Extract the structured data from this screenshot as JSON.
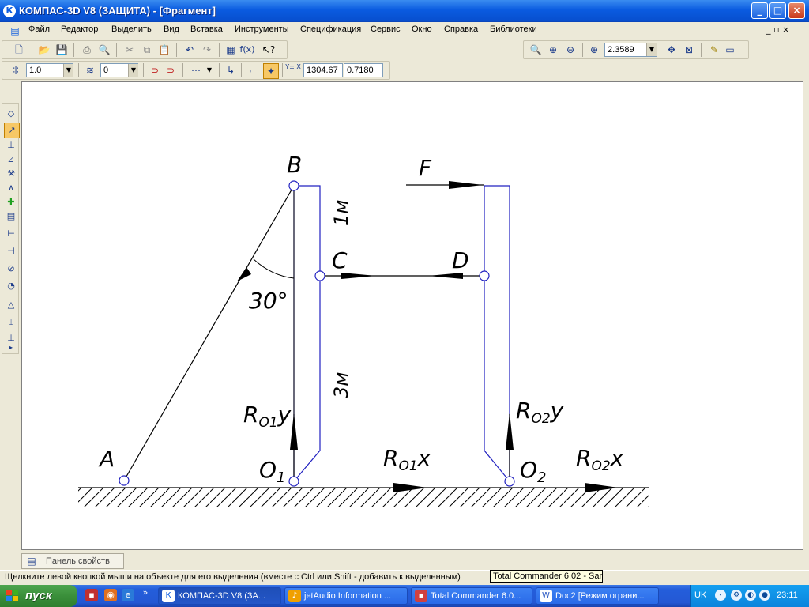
{
  "window": {
    "title": "КОМПАС-3D V8 (ЗАЩИТА) - [Фрагмент]",
    "icon": "kompas-icon",
    "buttons": {
      "minimize": "_",
      "maximize": "□",
      "close": "×"
    }
  },
  "menubar": {
    "items": [
      {
        "label": "Файл"
      },
      {
        "label": "Редактор"
      },
      {
        "label": "Выделить"
      },
      {
        "label": "Вид"
      },
      {
        "label": "Вставка"
      },
      {
        "label": "Инструменты"
      },
      {
        "label": "Спецификация"
      },
      {
        "label": "Сервис"
      },
      {
        "label": "Окно"
      },
      {
        "label": "Справка"
      },
      {
        "label": "Библиотеки"
      }
    ],
    "doc_controls": "_ ▫ ×"
  },
  "toolbar_standard": {
    "icons": [
      "new-icon",
      "open-icon",
      "save-icon",
      "print-icon",
      "preview-icon",
      "cut-icon",
      "copy-icon",
      "paste-icon",
      "undo-icon",
      "redo-icon",
      "variables-icon",
      "function-icon",
      "help-pointer-icon"
    ],
    "function_label": "f(x)"
  },
  "toolbar_view": {
    "zoom_value": "2.3589"
  },
  "toolbar_current_state": {
    "line_scale": "1.0",
    "layer": "0",
    "coord_label": "Y± X",
    "coord_x": "1304.67",
    "coord_y": "0.7180"
  },
  "drawing": {
    "labels": {
      "A": "A",
      "B": "B",
      "C": "C",
      "D": "D",
      "F": "F",
      "O1": "O",
      "O1_sub": "1",
      "O2": "O",
      "O2_sub": "2",
      "angle": "30°",
      "dim_upper": "1м",
      "dim_lower": "3м",
      "R01y": "R",
      "R01y_sub": "O1",
      "R01y_axis": "y",
      "R02y": "R",
      "R02y_sub": "O2",
      "R02y_axis": "y",
      "R01x": "R",
      "R01x_sub": "O1",
      "R01x_axis": "x",
      "R02x": "R",
      "R02x_sub": "O2",
      "R02x_axis": "x"
    },
    "colors": {
      "line": "#000000",
      "frame": "#2020c0"
    }
  },
  "properties_panel": {
    "tab_label": "Панель свойств"
  },
  "statusbar": {
    "message": "Щелкните левой кнопкой мыши на объекте для его выделения (вместе с Ctrl или Shift - добавить к выделенным)",
    "tooltip": "Total Commander 6.02 - Sam"
  },
  "taskbar": {
    "start_label": "пуск",
    "tasks": [
      {
        "label": "КОМПАС-3D V8 (ЗА...",
        "icon": "kompas-icon"
      },
      {
        "label": "jetAudio Information ...",
        "icon": "jetaudio-icon"
      },
      {
        "label": "Total Commander 6.0...",
        "icon": "floppy-icon"
      },
      {
        "label": "Doc2 [Режим ограни...",
        "icon": "word-icon"
      }
    ],
    "tray": {
      "language": "UK",
      "clock": "23:11"
    }
  }
}
